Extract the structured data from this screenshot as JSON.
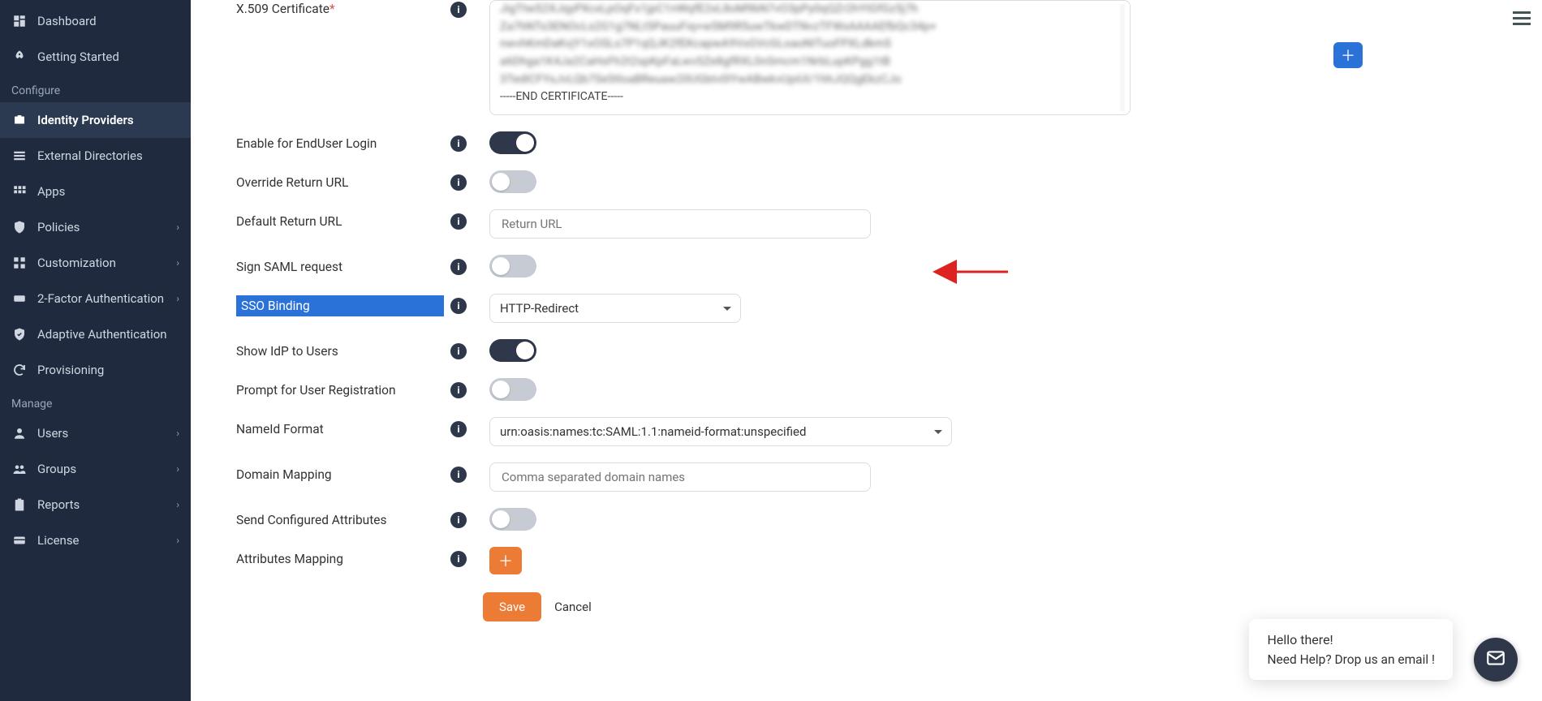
{
  "sidebar": {
    "section_configure": "Configure",
    "section_manage": "Manage",
    "items": {
      "dashboard": "Dashboard",
      "getting_started": "Getting Started",
      "identity_providers": "Identity Providers",
      "external_directories": "External Directories",
      "apps": "Apps",
      "policies": "Policies",
      "customization": "Customization",
      "two_factor": "2-Factor Authentication",
      "adaptive_auth": "Adaptive Authentication",
      "provisioning": "Provisioning",
      "users": "Users",
      "groups": "Groups",
      "reports": "Reports",
      "license": "License"
    }
  },
  "form": {
    "labels": {
      "x509": "X.509 Certificate",
      "enable_enduser": "Enable for EndUser Login",
      "override_return": "Override Return URL",
      "default_return": "Default Return URL",
      "sign_saml": "Sign SAML request",
      "sso_binding": "SSO Binding",
      "show_idp": "Show IdP to Users",
      "prompt_reg": "Prompt for User Registration",
      "nameid": "NameId Format",
      "domain_mapping": "Domain Mapping",
      "send_attrs": "Send Configured Attributes",
      "attr_mapping": "Attributes Mapping"
    },
    "cert_blurred_lines": [
      "JigTtwS2XJqyPXcxLpOqFx1jpC1nWqfE2xL8oM9bN7vO3pPy0qQZr2hYtGfGz5j7h",
      "Za7hNTs3ENOcLs2G1g7NLt5PauuFiq+wSM9R5uwTkwDTNvzTFWxAAAAEfbQc34p+",
      "nwvhKmDaKvjY1xOSLs7P1qQJK2fEKcapwA9VxGVcGLoaoNITuoFPXLdkmS",
      "a6Dhga1K4Ja2CaHsFh2t2spKpFaLwvSZe8gfRXL0nSmcm1NrbLupKPgg1tB",
      "3TedICFYsJvLQb7SeStloaBReuaw20UGbtv0lYwABwkvUpiUI/1hhJQQgEkzCJo"
    ],
    "cert_end": "-----END CERTIFICATE-----",
    "placeholders": {
      "return_url": "Return URL",
      "domain_mapping": "Comma separated domain names"
    },
    "values": {
      "sso_binding": "HTTP-Redirect",
      "nameid": "urn:oasis:names:tc:SAML:1.1:nameid-format:unspecified"
    },
    "toggles": {
      "enable_enduser": true,
      "override_return": false,
      "sign_saml": false,
      "show_idp": true,
      "prompt_reg": false,
      "send_attrs": false
    },
    "buttons": {
      "save": "Save",
      "cancel": "Cancel"
    }
  },
  "chat": {
    "line1": "Hello there!",
    "line2": "Need Help? Drop us an email !"
  }
}
